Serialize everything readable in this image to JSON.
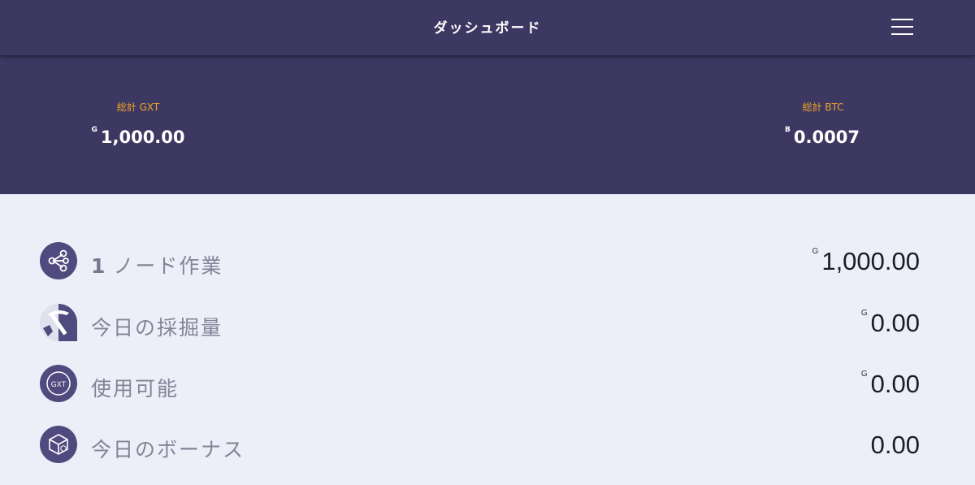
{
  "header": {
    "title": "ダッシュボード"
  },
  "summary": {
    "gxt": {
      "label": "総計 GXT",
      "currency_symbol": "G",
      "amount": "1,000.00"
    },
    "btc": {
      "label": "総計 BTC",
      "currency_symbol": "B",
      "amount": "0.0007"
    }
  },
  "stats": [
    {
      "count": "1",
      "label": "ノード作業",
      "currency_symbol": "G",
      "value": "1,000.00",
      "icon": "network-nodes-icon"
    },
    {
      "label": "今日の採掘量",
      "currency_symbol": "G",
      "value": "0.00",
      "icon": "pickaxe-icon"
    },
    {
      "label": "使用可能",
      "currency_symbol": "G",
      "value": "0.00",
      "icon": "gxt-coin-icon",
      "icon_text": "GXT"
    },
    {
      "label": "今日のボーナス",
      "value": "0.00",
      "icon": "bonus-box-icon"
    }
  ],
  "colors": {
    "header_bg": "#3d3862",
    "accent_label": "#f0a526",
    "page_bg": "#eceff8",
    "icon_bg": "#514a7f"
  }
}
